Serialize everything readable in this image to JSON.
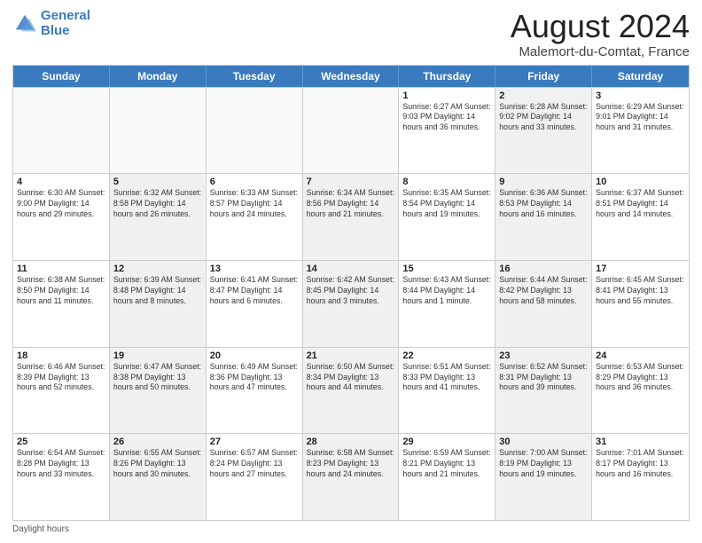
{
  "header": {
    "logo_line1": "General",
    "logo_line2": "Blue",
    "month_title": "August 2024",
    "location": "Malemort-du-Comtat, France"
  },
  "days_of_week": [
    "Sunday",
    "Monday",
    "Tuesday",
    "Wednesday",
    "Thursday",
    "Friday",
    "Saturday"
  ],
  "weeks": [
    [
      {
        "day": "",
        "info": "",
        "empty": true
      },
      {
        "day": "",
        "info": "",
        "empty": true
      },
      {
        "day": "",
        "info": "",
        "empty": true
      },
      {
        "day": "",
        "info": "",
        "empty": true
      },
      {
        "day": "1",
        "info": "Sunrise: 6:27 AM\nSunset: 9:03 PM\nDaylight: 14 hours and 36 minutes."
      },
      {
        "day": "2",
        "info": "Sunrise: 6:28 AM\nSunset: 9:02 PM\nDaylight: 14 hours and 33 minutes.",
        "shaded": true
      },
      {
        "day": "3",
        "info": "Sunrise: 6:29 AM\nSunset: 9:01 PM\nDaylight: 14 hours and 31 minutes."
      }
    ],
    [
      {
        "day": "4",
        "info": "Sunrise: 6:30 AM\nSunset: 9:00 PM\nDaylight: 14 hours and 29 minutes."
      },
      {
        "day": "5",
        "info": "Sunrise: 6:32 AM\nSunset: 8:58 PM\nDaylight: 14 hours and 26 minutes.",
        "shaded": true
      },
      {
        "day": "6",
        "info": "Sunrise: 6:33 AM\nSunset: 8:57 PM\nDaylight: 14 hours and 24 minutes."
      },
      {
        "day": "7",
        "info": "Sunrise: 6:34 AM\nSunset: 8:56 PM\nDaylight: 14 hours and 21 minutes.",
        "shaded": true
      },
      {
        "day": "8",
        "info": "Sunrise: 6:35 AM\nSunset: 8:54 PM\nDaylight: 14 hours and 19 minutes."
      },
      {
        "day": "9",
        "info": "Sunrise: 6:36 AM\nSunset: 8:53 PM\nDaylight: 14 hours and 16 minutes.",
        "shaded": true
      },
      {
        "day": "10",
        "info": "Sunrise: 6:37 AM\nSunset: 8:51 PM\nDaylight: 14 hours and 14 minutes."
      }
    ],
    [
      {
        "day": "11",
        "info": "Sunrise: 6:38 AM\nSunset: 8:50 PM\nDaylight: 14 hours and 11 minutes."
      },
      {
        "day": "12",
        "info": "Sunrise: 6:39 AM\nSunset: 8:48 PM\nDaylight: 14 hours and 8 minutes.",
        "shaded": true
      },
      {
        "day": "13",
        "info": "Sunrise: 6:41 AM\nSunset: 8:47 PM\nDaylight: 14 hours and 6 minutes."
      },
      {
        "day": "14",
        "info": "Sunrise: 6:42 AM\nSunset: 8:45 PM\nDaylight: 14 hours and 3 minutes.",
        "shaded": true
      },
      {
        "day": "15",
        "info": "Sunrise: 6:43 AM\nSunset: 8:44 PM\nDaylight: 14 hours and 1 minute."
      },
      {
        "day": "16",
        "info": "Sunrise: 6:44 AM\nSunset: 8:42 PM\nDaylight: 13 hours and 58 minutes.",
        "shaded": true
      },
      {
        "day": "17",
        "info": "Sunrise: 6:45 AM\nSunset: 8:41 PM\nDaylight: 13 hours and 55 minutes."
      }
    ],
    [
      {
        "day": "18",
        "info": "Sunrise: 6:46 AM\nSunset: 8:39 PM\nDaylight: 13 hours and 52 minutes."
      },
      {
        "day": "19",
        "info": "Sunrise: 6:47 AM\nSunset: 8:38 PM\nDaylight: 13 hours and 50 minutes.",
        "shaded": true
      },
      {
        "day": "20",
        "info": "Sunrise: 6:49 AM\nSunset: 8:36 PM\nDaylight: 13 hours and 47 minutes."
      },
      {
        "day": "21",
        "info": "Sunrise: 6:50 AM\nSunset: 8:34 PM\nDaylight: 13 hours and 44 minutes.",
        "shaded": true
      },
      {
        "day": "22",
        "info": "Sunrise: 6:51 AM\nSunset: 8:33 PM\nDaylight: 13 hours and 41 minutes."
      },
      {
        "day": "23",
        "info": "Sunrise: 6:52 AM\nSunset: 8:31 PM\nDaylight: 13 hours and 39 minutes.",
        "shaded": true
      },
      {
        "day": "24",
        "info": "Sunrise: 6:53 AM\nSunset: 8:29 PM\nDaylight: 13 hours and 36 minutes."
      }
    ],
    [
      {
        "day": "25",
        "info": "Sunrise: 6:54 AM\nSunset: 8:28 PM\nDaylight: 13 hours and 33 minutes."
      },
      {
        "day": "26",
        "info": "Sunrise: 6:55 AM\nSunset: 8:26 PM\nDaylight: 13 hours and 30 minutes.",
        "shaded": true
      },
      {
        "day": "27",
        "info": "Sunrise: 6:57 AM\nSunset: 8:24 PM\nDaylight: 13 hours and 27 minutes."
      },
      {
        "day": "28",
        "info": "Sunrise: 6:58 AM\nSunset: 8:23 PM\nDaylight: 13 hours and 24 minutes.",
        "shaded": true
      },
      {
        "day": "29",
        "info": "Sunrise: 6:59 AM\nSunset: 8:21 PM\nDaylight: 13 hours and 21 minutes."
      },
      {
        "day": "30",
        "info": "Sunrise: 7:00 AM\nSunset: 8:19 PM\nDaylight: 13 hours and 19 minutes.",
        "shaded": true
      },
      {
        "day": "31",
        "info": "Sunrise: 7:01 AM\nSunset: 8:17 PM\nDaylight: 13 hours and 16 minutes."
      }
    ]
  ],
  "footer": {
    "daylight_label": "Daylight hours"
  }
}
